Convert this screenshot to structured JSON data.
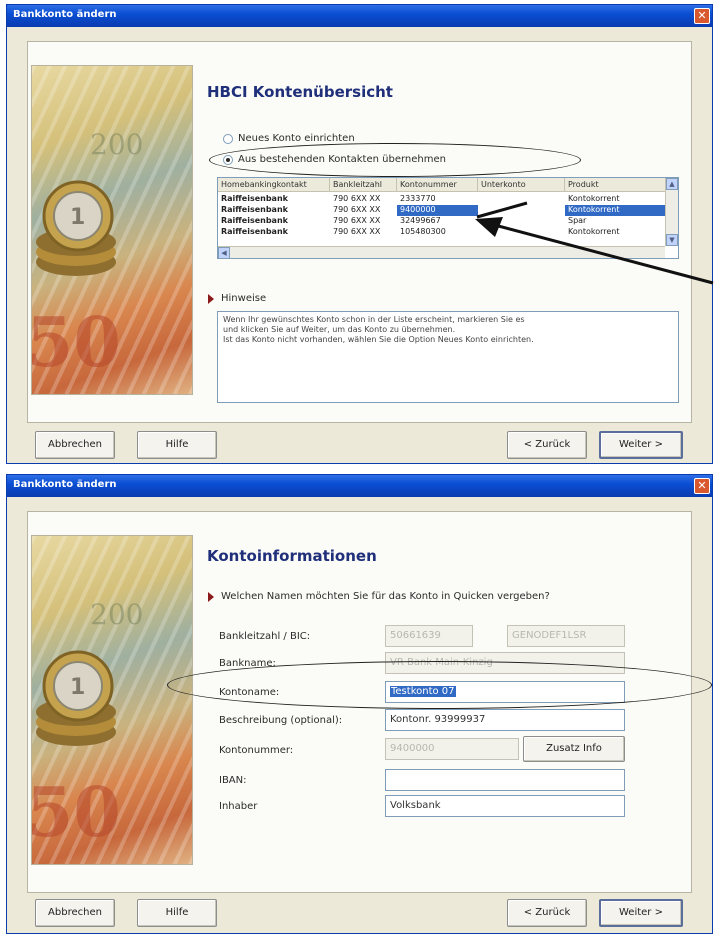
{
  "window1": {
    "title": "Bankkonto ändern",
    "heading": "HBCI Kontenübersicht",
    "radio_new": "Neues Konto einrichten",
    "radio_existing": "Aus bestehenden Kontakten übernehmen",
    "table": {
      "columns": [
        "Homebankingkontakt",
        "Bankleitzahl",
        "Kontonummer",
        "Unterkonto",
        "Produkt"
      ],
      "rows": [
        [
          "Raiffeisenbank",
          "790 6XX XX",
          "2333770",
          "",
          "Kontokorrent"
        ],
        [
          "Raiffeisenbank",
          "790 6XX XX",
          "9400000",
          "",
          "Kontokorrent"
        ],
        [
          "Raiffeisenbank",
          "790 6XX XX",
          "32499667",
          "",
          "Spar"
        ],
        [
          "Raiffeisenbank",
          "790 6XX XX",
          "105480300",
          "",
          "Kontokorrent"
        ]
      ],
      "selected_row": 1
    },
    "hints_label": "Hinweise",
    "hints_line1": "Wenn Ihr gewünschtes Konto schon in der Liste erscheint, markieren Sie es",
    "hints_line2": "und klicken Sie auf Weiter, um das Konto zu übernehmen.",
    "hints_line3": "Ist das Konto nicht vorhanden, wählen Sie die Option Neues Konto einrichten.",
    "buttons": {
      "cancel": "Abbrechen",
      "help": "Hilfe",
      "back": "< Zurück",
      "next": "Weiter >"
    }
  },
  "window2": {
    "title": "Bankkonto ändern",
    "heading": "Kontoinformationen",
    "question": "Welchen Namen möchten Sie für das Konto in Quicken vergeben?",
    "fields": {
      "blz_label": "Bankleitzahl / BIC:",
      "blz_value": "50661639",
      "bic_value": "GENODEF1LSR",
      "bankname_label": "Bankname:",
      "bankname_value": "VR Bank Main-Kinzig",
      "kontoname_label": "Kontoname:",
      "kontoname_value": "Testkonto 07",
      "beschreibung_label": "Beschreibung (optional):",
      "beschreibung_value": "Kontonr. 93999937",
      "kontonummer_label": "Kontonummer:",
      "kontonummer_value": "9400000",
      "zusatz_button": "Zusatz Info",
      "iban_label": "IBAN:",
      "iban_value": "",
      "inhaber_label": "Inhaber",
      "inhaber_value": "Volksbank"
    },
    "buttons": {
      "cancel": "Abbrechen",
      "help": "Hilfe",
      "back": "< Zurück",
      "next": "Weiter >"
    }
  },
  "icons": {
    "close": "close-icon",
    "section_marker": "triangle-right-icon",
    "scroll_up": "chevron-up-icon",
    "scroll_down": "chevron-down-icon",
    "scroll_left": "chevron-left-icon"
  },
  "colors": {
    "title_bar": "#0a4ed3",
    "heading": "#1f2f7a",
    "selection": "#316ac5",
    "section_marker": "#8b1a1a"
  }
}
